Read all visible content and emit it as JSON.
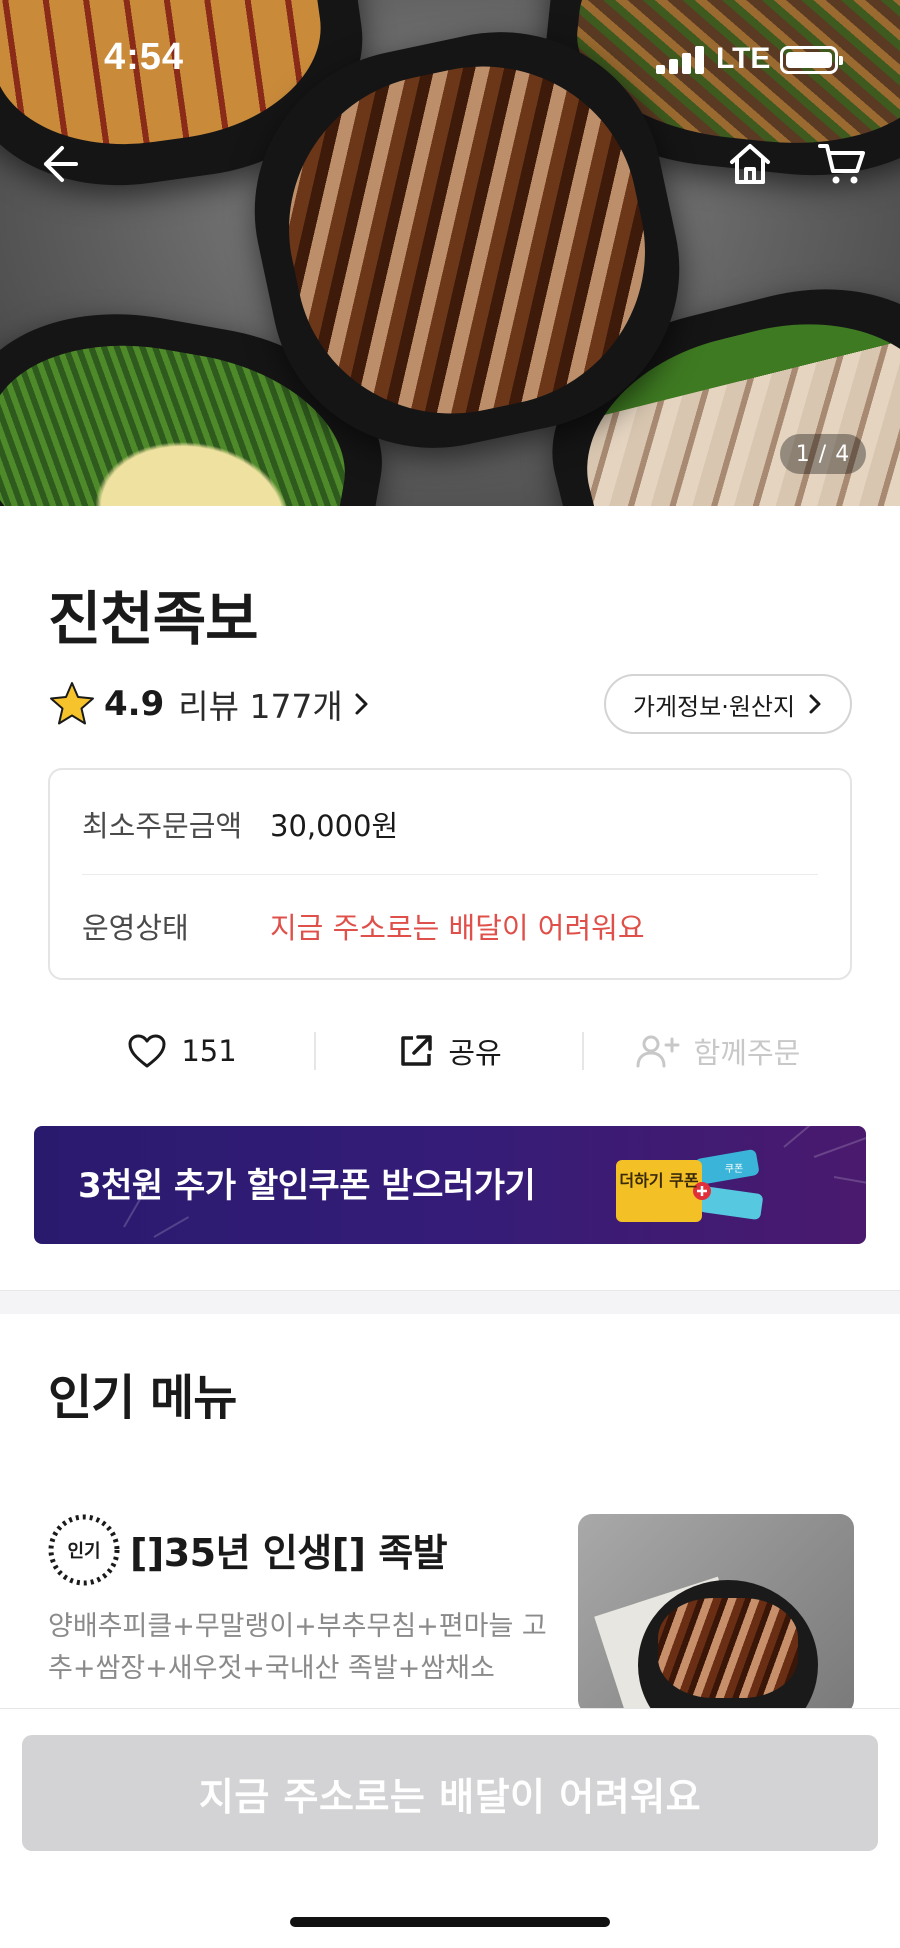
{
  "status_bar": {
    "time": "4:54",
    "network": "LTE"
  },
  "hero": {
    "photo_counter": "1 / 4",
    "icons": [
      "back-arrow-icon",
      "home-icon",
      "cart-icon"
    ]
  },
  "store": {
    "name": "진천족보",
    "rating": "4.9",
    "review_label": "리뷰 177개",
    "info_button": "가게정보·원산지"
  },
  "info_box": {
    "rows": [
      {
        "label": "최소주문금액",
        "value": "30,000원"
      },
      {
        "label": "운영상태",
        "value": "지금 주소로는 배달이 어려워요"
      }
    ],
    "warning_color": "#e0504a"
  },
  "actions": {
    "like_count": "151",
    "share_label": "공유",
    "group_order_label": "함께주문"
  },
  "coupon_banner": {
    "text": "3천원 추가 할인쿠폰 받으러가기",
    "ticket_text": "더하기 쿠폰",
    "ticket_small": "쿠폰",
    "background": "#2a1a6e"
  },
  "popular_menu": {
    "title": "인기 메뉴",
    "items": [
      {
        "badge": "인기",
        "name": "[]35년 인생[] 족발",
        "description": "양배추피클+무말랭이+부추무침+편마늘 고추+쌈장+새우젓+국내산 족발+쌈채소"
      }
    ]
  },
  "bottom": {
    "order_button": "지금 주소로는 배달이 어려워요"
  }
}
